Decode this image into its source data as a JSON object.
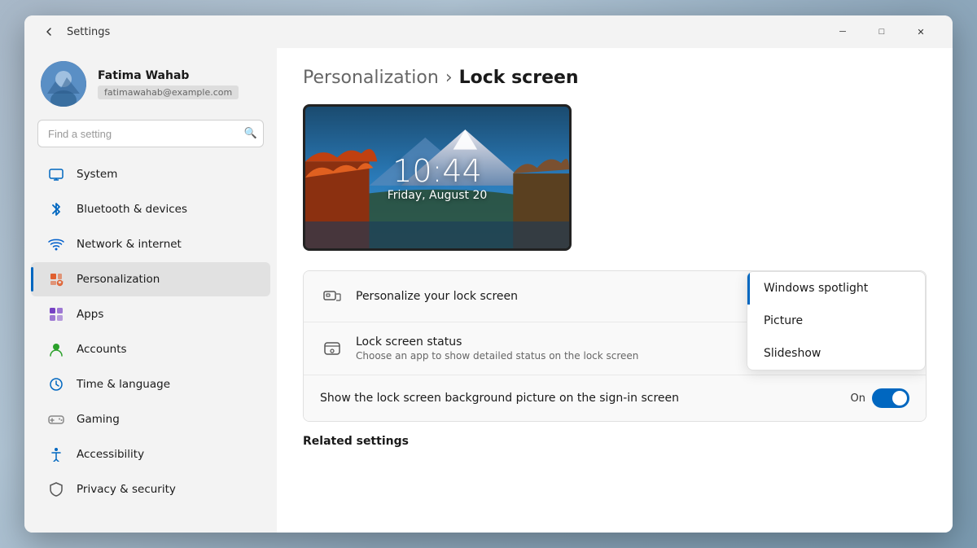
{
  "window": {
    "title": "Settings",
    "back_button": "←",
    "controls": {
      "minimize": "─",
      "maximize": "□",
      "close": "✕"
    }
  },
  "user": {
    "name": "Fatima Wahab",
    "email": "fatimawahab@example.com"
  },
  "search": {
    "placeholder": "Find a setting"
  },
  "nav": {
    "items": [
      {
        "id": "system",
        "label": "System",
        "active": false
      },
      {
        "id": "bluetooth",
        "label": "Bluetooth & devices",
        "active": false
      },
      {
        "id": "network",
        "label": "Network & internet",
        "active": false
      },
      {
        "id": "personalization",
        "label": "Personalization",
        "active": true
      },
      {
        "id": "apps",
        "label": "Apps",
        "active": false
      },
      {
        "id": "accounts",
        "label": "Accounts",
        "active": false
      },
      {
        "id": "time",
        "label": "Time & language",
        "active": false
      },
      {
        "id": "gaming",
        "label": "Gaming",
        "active": false
      },
      {
        "id": "accessibility",
        "label": "Accessibility",
        "active": false
      },
      {
        "id": "privacy",
        "label": "Privacy & security",
        "active": false
      }
    ]
  },
  "breadcrumb": {
    "parent": "Personalization",
    "separator": "›",
    "current": "Lock screen"
  },
  "lockscreen": {
    "time": "10:44",
    "date": "Friday, August 20"
  },
  "settings": {
    "rows": [
      {
        "id": "personalize",
        "title": "Personalize your lock screen",
        "subtitle": "",
        "has_dropdown": true
      },
      {
        "id": "status",
        "title": "Lock screen status",
        "subtitle": "Choose an app to show detailed status on the lock screen",
        "has_dropdown": false
      },
      {
        "id": "background",
        "title": "Show the lock screen background picture on the sign-in screen",
        "subtitle": "",
        "toggle": "On",
        "has_dropdown": false
      }
    ]
  },
  "dropdown": {
    "items": [
      {
        "id": "spotlight",
        "label": "Windows spotlight",
        "selected": true
      },
      {
        "id": "picture",
        "label": "Picture",
        "selected": false
      },
      {
        "id": "slideshow",
        "label": "Slideshow",
        "selected": false
      }
    ]
  },
  "related_settings": {
    "title": "Related settings"
  }
}
